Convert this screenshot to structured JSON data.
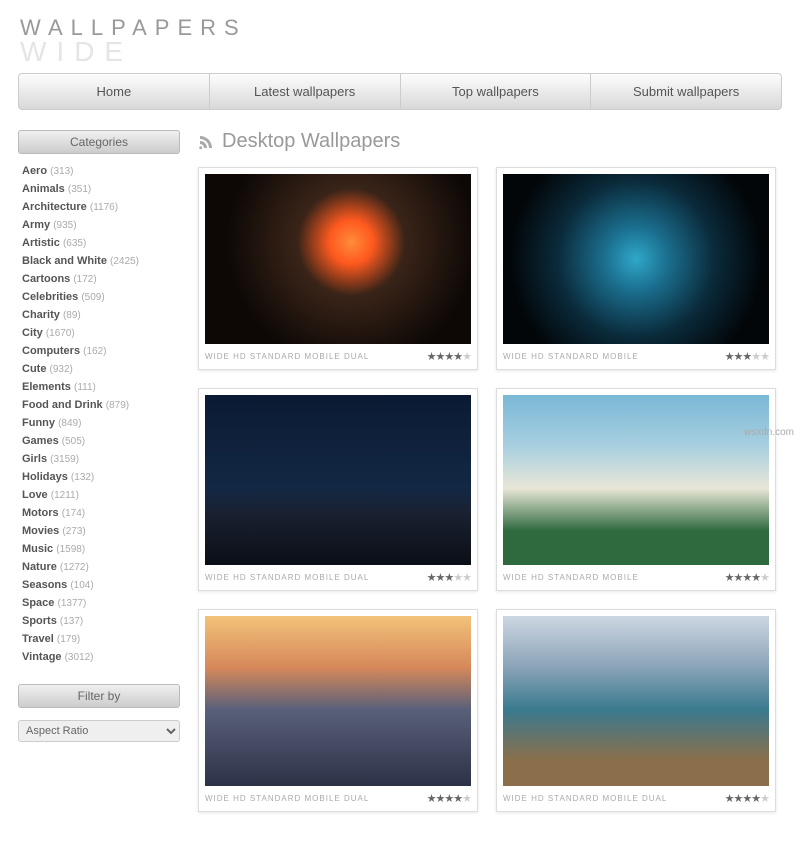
{
  "logo": {
    "top": "WALLPAPERS",
    "bottom": "WIDE"
  },
  "nav": [
    "Home",
    "Latest wallpapers",
    "Top wallpapers",
    "Submit wallpapers"
  ],
  "sidebar": {
    "categories_title": "Categories",
    "categories": [
      {
        "name": "Aero",
        "count": "(313)"
      },
      {
        "name": "Animals",
        "count": "(351)"
      },
      {
        "name": "Architecture",
        "count": "(1176)"
      },
      {
        "name": "Army",
        "count": "(935)"
      },
      {
        "name": "Artistic",
        "count": "(635)"
      },
      {
        "name": "Black and White",
        "count": "(2425)"
      },
      {
        "name": "Cartoons",
        "count": "(172)"
      },
      {
        "name": "Celebrities",
        "count": "(509)"
      },
      {
        "name": "Charity",
        "count": "(89)"
      },
      {
        "name": "City",
        "count": "(1670)"
      },
      {
        "name": "Computers",
        "count": "(162)"
      },
      {
        "name": "Cute",
        "count": "(932)"
      },
      {
        "name": "Elements",
        "count": "(111)"
      },
      {
        "name": "Food and Drink",
        "count": "(879)"
      },
      {
        "name": "Funny",
        "count": "(849)"
      },
      {
        "name": "Games",
        "count": "(505)"
      },
      {
        "name": "Girls",
        "count": "(3159)"
      },
      {
        "name": "Holidays",
        "count": "(132)"
      },
      {
        "name": "Love",
        "count": "(1211)"
      },
      {
        "name": "Motors",
        "count": "(174)"
      },
      {
        "name": "Movies",
        "count": "(273)"
      },
      {
        "name": "Music",
        "count": "(1598)"
      },
      {
        "name": "Nature",
        "count": "(1272)"
      },
      {
        "name": "Seasons",
        "count": "(104)"
      },
      {
        "name": "Space",
        "count": "(1377)"
      },
      {
        "name": "Sports",
        "count": "(137)"
      },
      {
        "name": "Travel",
        "count": "(179)"
      },
      {
        "name": "Vintage",
        "count": "(3012)"
      }
    ],
    "filter_title": "Filter by",
    "filter_selected": "Aspect Ratio"
  },
  "content": {
    "title": "Desktop Wallpapers",
    "cards": [
      {
        "formats": "WIDE HD STANDARD MOBILE DUAL",
        "stars": 4,
        "grad": "eclipse"
      },
      {
        "formats": "WIDE HD STANDARD MOBILE",
        "stars": 3,
        "grad": "earth"
      },
      {
        "formats": "WIDE HD STANDARD MOBILE DUAL",
        "stars": 3,
        "grad": "dune"
      },
      {
        "formats": "WIDE HD STANDARD MOBILE",
        "stars": 4,
        "grad": "clouds"
      },
      {
        "formats": "WIDE HD STANDARD MOBILE DUAL",
        "stars": 4,
        "grad": "city"
      },
      {
        "formats": "WIDE HD STANDARD MOBILE DUAL",
        "stars": 4,
        "grad": "lake"
      }
    ]
  },
  "watermark": "wsxdn.com"
}
